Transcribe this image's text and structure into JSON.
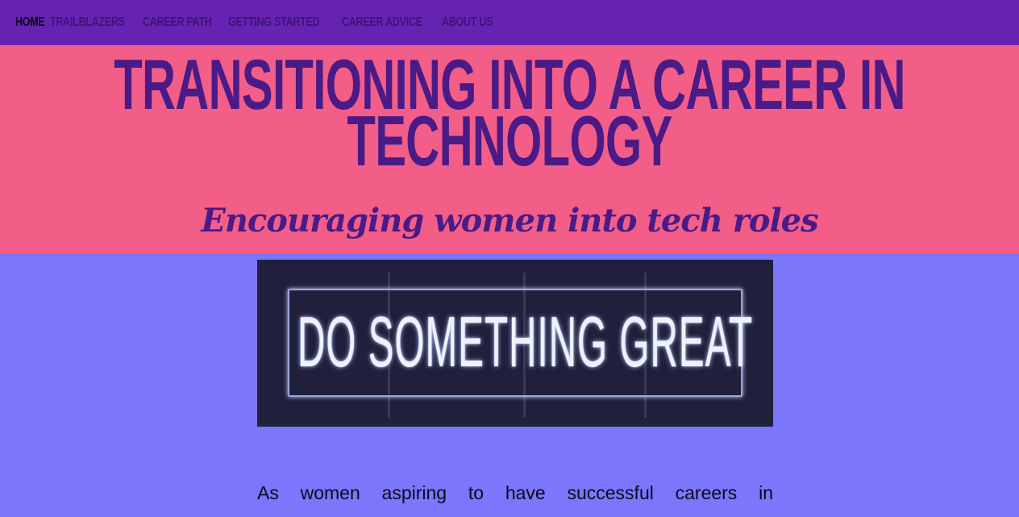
{
  "nav": {
    "items": [
      {
        "label": "Home"
      },
      {
        "label": "Trailblazers"
      },
      {
        "label": "Career Path"
      },
      {
        "label": "Getting Started"
      },
      {
        "label": "Career Advice"
      },
      {
        "label": "About Us"
      }
    ],
    "active_color": "#0a0416",
    "color": "#3c1477"
  },
  "hero": {
    "title": "Transitioning into a career in Technology",
    "subtitle": "Encouraging women into tech roles"
  },
  "banner": {
    "image_text": "DO SOMETHING GREAT"
  },
  "intro": {
    "text": "As women aspiring to have successful careers in"
  },
  "colors": {
    "navbar": "#6623b1",
    "hero": "#f25e88",
    "page": "#7b76fb",
    "title": "#4a1b86"
  }
}
